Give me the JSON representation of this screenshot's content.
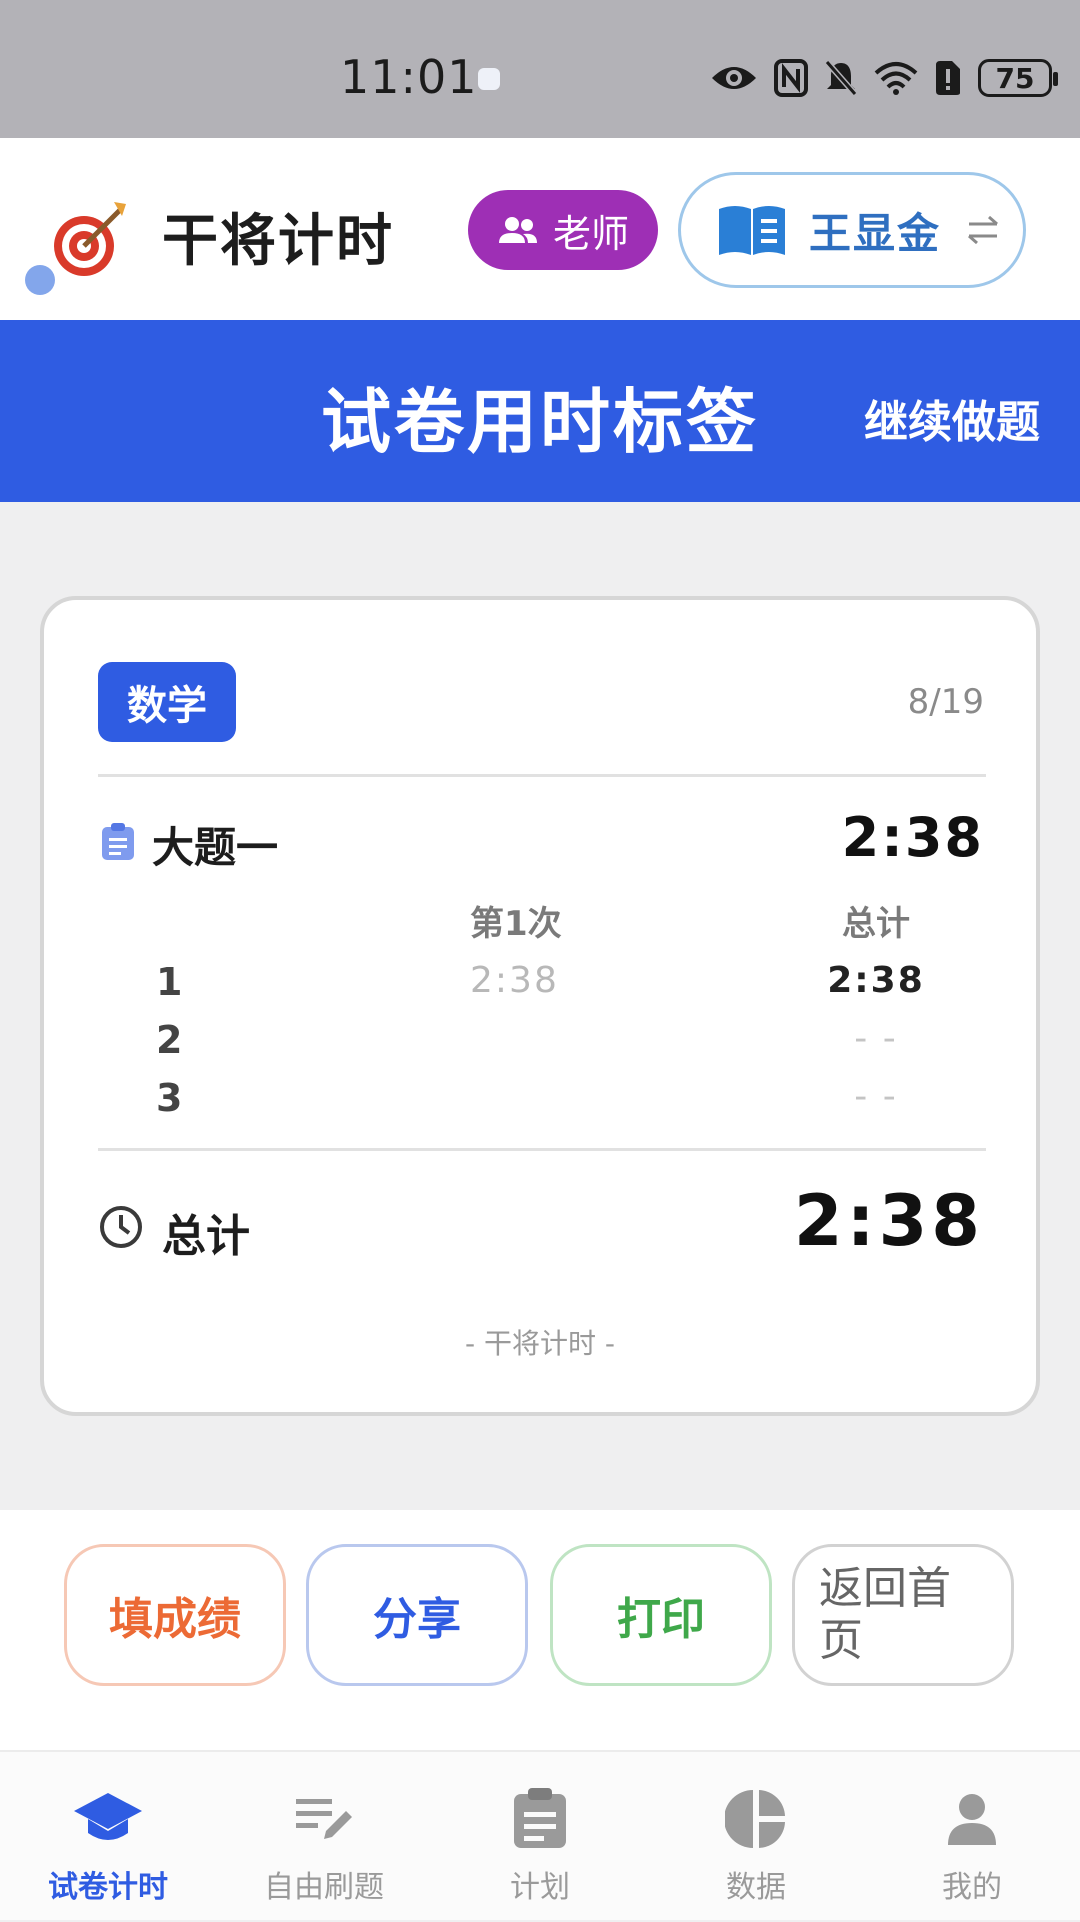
{
  "status_bar": {
    "time": "11:01",
    "battery": "75"
  },
  "header": {
    "app_title": "干将计时",
    "role_label": "老师",
    "student_name": "王显金"
  },
  "banner": {
    "title": "试卷用时标签",
    "action": "继续做题"
  },
  "card": {
    "subject": "数学",
    "progress": "8/19",
    "section": {
      "name": "大题一",
      "time": "2:38"
    },
    "columns": {
      "attempt": "第1次",
      "total": "总计"
    },
    "rows": [
      {
        "num": "1",
        "attempt": "2:38",
        "total": "2:38"
      },
      {
        "num": "2",
        "attempt": "",
        "total": "- -"
      },
      {
        "num": "3",
        "attempt": "",
        "total": "- -"
      }
    ],
    "total_label": "总计",
    "grand_total": "2:38",
    "watermark": "- 干将计时 -"
  },
  "actions": {
    "fill_score": "填成绩",
    "share": "分享",
    "print": "打印",
    "back_home": "返回首页"
  },
  "tabs": [
    {
      "label": "试卷计时",
      "icon": "graduation-cap-icon",
      "active": true
    },
    {
      "label": "自由刷题",
      "icon": "edit-list-icon",
      "active": false
    },
    {
      "label": "计划",
      "icon": "clipboard-icon",
      "active": false
    },
    {
      "label": "数据",
      "icon": "pie-chart-icon",
      "active": false
    },
    {
      "label": "我的",
      "icon": "person-icon",
      "active": false
    }
  ],
  "colors": {
    "primary_blue": "#2f5ce2",
    "role_purple": "#9e2fb5",
    "score_orange": "#ec6a35",
    "print_green": "#3fa84a"
  }
}
